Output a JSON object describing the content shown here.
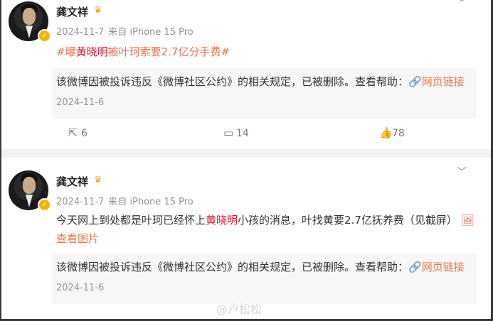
{
  "post1": {
    "author": "龚文祥",
    "crown": "♛",
    "date": "2024-11-7",
    "source": "来自 iPhone 15 Pro",
    "topic": {
      "prefix": "#曝",
      "name": "黄晓明",
      "suffix": "被叶珂索要2.7亿分手费#"
    },
    "removed_notice": {
      "text": "该微博因被投诉违反《微博社区公约》的相关规定，已被删除。查看帮助：",
      "link": "🔗网页链接"
    },
    "removed_date": "2024-11-6",
    "actions": {
      "share": "6",
      "comment": "14",
      "like": "78"
    }
  },
  "post2": {
    "author": "龚文祥",
    "crown": "♛",
    "date": "2024-11-7",
    "source": "来自 iPhone 15 Pro",
    "text_before": "今天网上到处都是叶珂已经怀上",
    "name": "黄晓明",
    "text_after": "小孩的消息，叶找黄要2.7亿抚养费（见截屏）",
    "image_link": "🖼查看图片",
    "removed_notice": {
      "text": "该微博因被投诉违反《微博社区公约》的相关规定，已被删除。查看帮助：",
      "link": "🔗网页链接"
    },
    "removed_date": "2024-11-6"
  },
  "watermark": "@卢松松"
}
